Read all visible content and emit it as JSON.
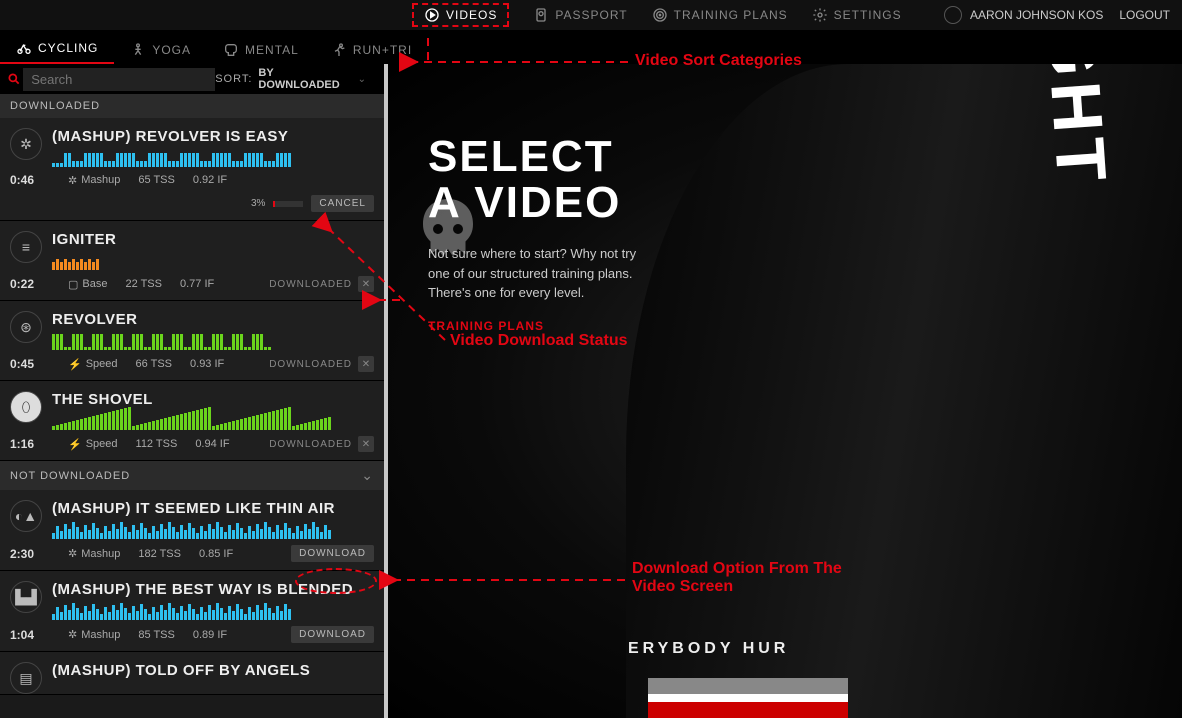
{
  "topnav": {
    "videos": "VIDEOS",
    "passport": "PASSPORT",
    "training_plans": "TRAINING PLANS",
    "settings": "SETTINGS",
    "username": "AARON JOHNSON KOS",
    "logout": "LOGOUT"
  },
  "sports": {
    "cycling": "CYCLING",
    "yoga": "YOGA",
    "mental": "MENTAL",
    "runtri": "RUN+TRI"
  },
  "search": {
    "placeholder": "Search",
    "sort_label": "SORT:",
    "sort_value": "BY DOWNLOADED"
  },
  "sections": {
    "downloaded": "DOWNLOADED",
    "not_downloaded": "NOT DOWNLOADED"
  },
  "status_labels": {
    "cancel": "CANCEL",
    "downloaded": "DOWNLOADED",
    "download": "DOWNLOAD"
  },
  "progress_percent": "3%",
  "items": {
    "0": {
      "title": "(MASHUP) REVOLVER IS EASY",
      "dur": "0:46",
      "cat": "Mashup",
      "tss": "65 TSS",
      "if": "0.92 IF",
      "color": "#2ec0f0"
    },
    "1": {
      "title": "IGNITER",
      "dur": "0:22",
      "cat": "Base",
      "tss": "22 TSS",
      "if": "0.77 IF",
      "color": "#f58a1f"
    },
    "2": {
      "title": "REVOLVER",
      "dur": "0:45",
      "cat": "Speed",
      "tss": "66 TSS",
      "if": "0.93 IF",
      "color": "#6ad31c"
    },
    "3": {
      "title": "THE SHOVEL",
      "dur": "1:16",
      "cat": "Speed",
      "tss": "112 TSS",
      "if": "0.94 IF",
      "color": "#6ad31c"
    },
    "4": {
      "title": "(MASHUP) IT SEEMED LIKE THIN AIR",
      "dur": "2:30",
      "cat": "Mashup",
      "tss": "182 TSS",
      "if": "0.85 IF",
      "color": "#2ec0f0"
    },
    "5": {
      "title": "(MASHUP) THE BEST WAY IS BLENDED",
      "dur": "1:04",
      "cat": "Mashup",
      "tss": "85 TSS",
      "if": "0.89 IF",
      "color": "#2ec0f0"
    },
    "6": {
      "title": "(MASHUP) TOLD OFF BY ANGELS",
      "dur": "",
      "cat": "",
      "tss": "",
      "if": "",
      "color": "#2ec0f0"
    }
  },
  "hero": {
    "heading1": "SELECT",
    "heading2": "A VIDEO",
    "body": "Not sure where to start? Why not try one of our structured training plans. There's one for every level.",
    "link": "TRAINING PLANS",
    "brand": "KNIGHT",
    "slogan": "ERYBODY HUR"
  },
  "annotations": {
    "a1": "Video Sort Categories",
    "a2": "Video Download Status",
    "a3": "Download Option From The\nVideo Screen"
  }
}
